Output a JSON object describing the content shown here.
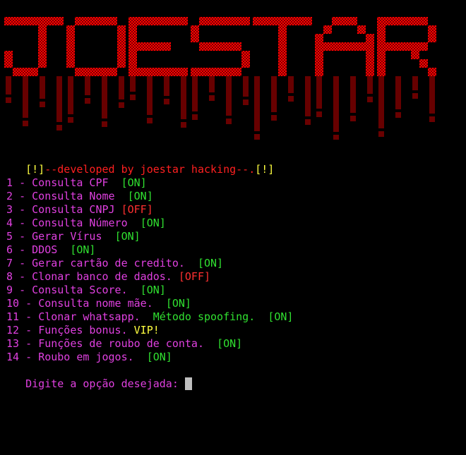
{
  "banner": {
    "text": "JOESTAR",
    "color": "#ff0000"
  },
  "credits": {
    "bracket_open": "[!]",
    "text": "--developed by joestar hacking--.",
    "bracket_close": "[!]"
  },
  "menu": [
    {
      "prefix": " 1 - ",
      "label": "Consulta CPF  ",
      "status": "[ON]",
      "status_type": "on"
    },
    {
      "prefix": " 2 - ",
      "label": "Consulta Nome  ",
      "status": "[ON]",
      "status_type": "on"
    },
    {
      "prefix": " 3 - ",
      "label": "Consulta CNPJ ",
      "status": "[OFF]",
      "status_type": "off"
    },
    {
      "prefix": " 4 - ",
      "label": "Consulta Número  ",
      "status": "[ON]",
      "status_type": "on"
    },
    {
      "prefix": " 5 - ",
      "label": "Gerar Vírus  ",
      "status": "[ON]",
      "status_type": "on"
    },
    {
      "prefix": " 6 - ",
      "label": "DDOS  ",
      "status": "[ON]",
      "status_type": "on"
    },
    {
      "prefix": " 7 - ",
      "label": "Gerar cartão de credito.  ",
      "status": "[ON]",
      "status_type": "on"
    },
    {
      "prefix": " 8 - ",
      "label": "Clonar banco de dados. ",
      "status": "[OFF]",
      "status_type": "off"
    },
    {
      "prefix": " 9 - ",
      "label": "Consulta Score.  ",
      "status": "[ON]",
      "status_type": "on"
    },
    {
      "prefix": " 10 - ",
      "label": "Consulta nome mãe.  ",
      "status": "[ON]",
      "status_type": "on"
    },
    {
      "prefix": " 11 - ",
      "label": "Clonar whatsapp.  ",
      "extra": "Método spoofing.  ",
      "status": "[ON]",
      "status_type": "on"
    },
    {
      "prefix": " 12 - ",
      "label": "Funções bonus. ",
      "status": "VIP!",
      "status_type": "vip"
    },
    {
      "prefix": " 13 - ",
      "label": "Funções de roubo de conta.  ",
      "status": "[ON]",
      "status_type": "on"
    },
    {
      "prefix": " 14 - ",
      "label": "Roubo em jogos.  ",
      "status": "[ON]",
      "status_type": "on"
    }
  ],
  "prompt": {
    "text": "Digite a opção desejada: ",
    "input_value": ""
  },
  "colors": {
    "background": "#000000",
    "menu_text": "#e040e0",
    "on": "#30e030",
    "off": "#ff3030",
    "vip": "#ffff40",
    "credits_text": "#ff2020",
    "credits_bracket": "#ffff40"
  }
}
